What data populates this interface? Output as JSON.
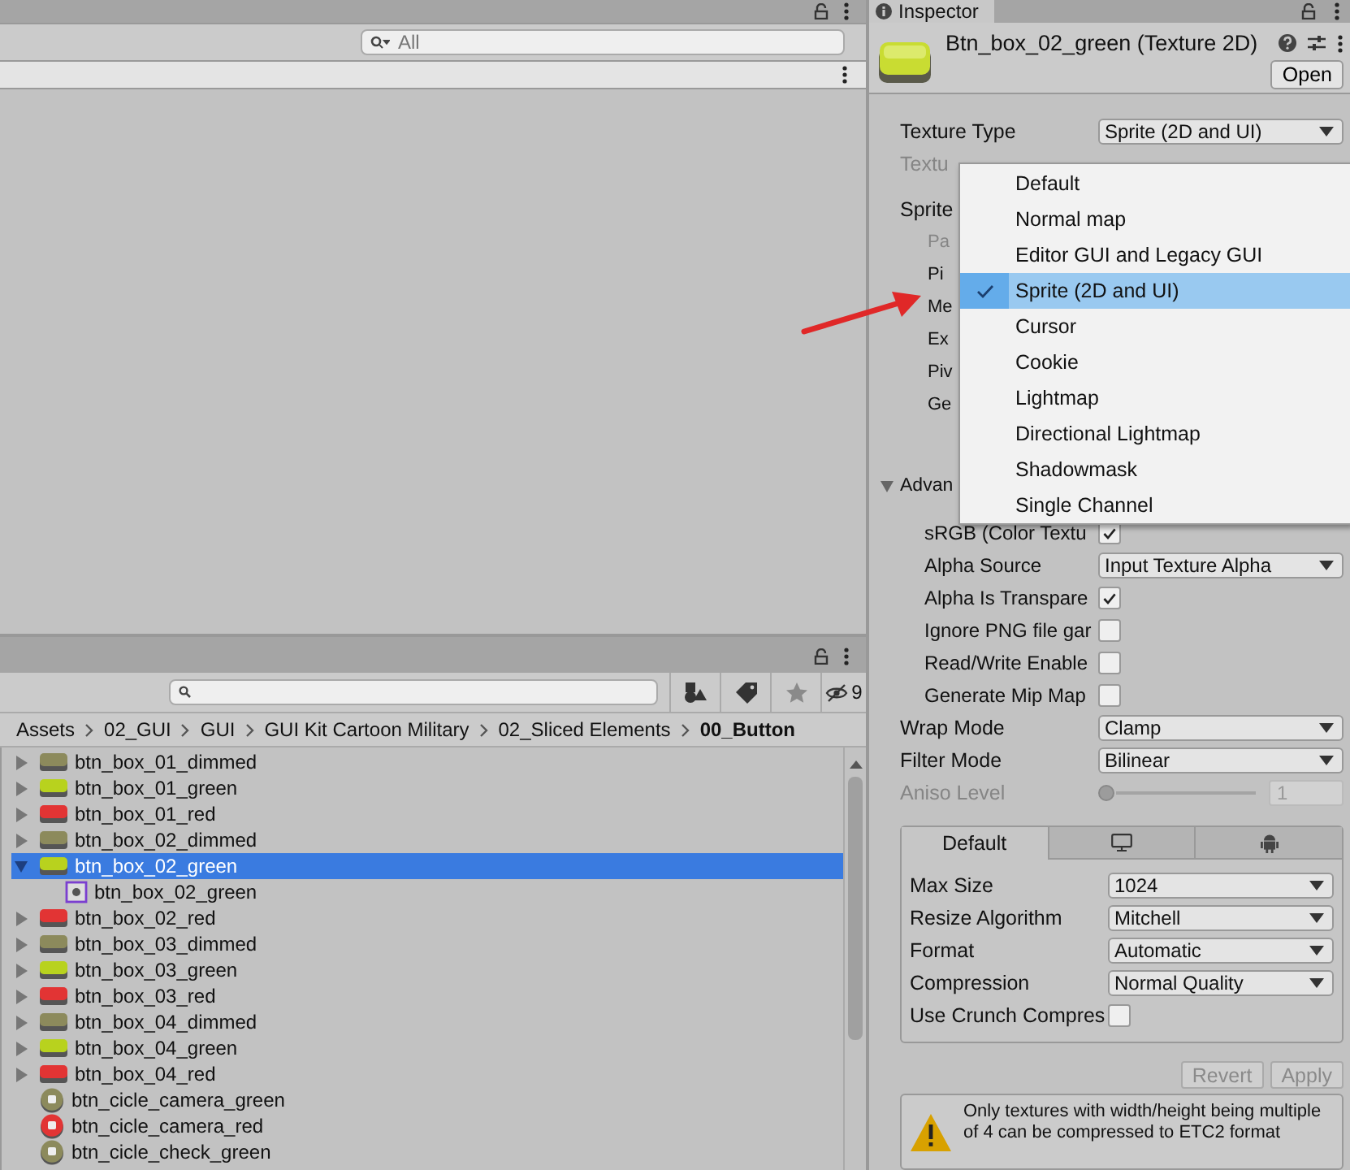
{
  "scene_panel": {
    "search": {
      "placeholder": "All"
    }
  },
  "project_panel": {
    "hidden_count": "9",
    "breadcrumb": [
      "Assets",
      "02_GUI",
      "GUI",
      "GUI Kit Cartoon Military",
      "02_Sliced Elements",
      "00_Button"
    ],
    "assets": [
      {
        "kind": "box",
        "name": "btn_box_01_dimmed",
        "color": "#8c8a5c",
        "expanded": false,
        "selected": false
      },
      {
        "kind": "box",
        "name": "btn_box_01_green",
        "color": "#b8d21e",
        "expanded": false,
        "selected": false
      },
      {
        "kind": "box",
        "name": "btn_box_01_red",
        "color": "#e23434",
        "expanded": false,
        "selected": false
      },
      {
        "kind": "box",
        "name": "btn_box_02_dimmed",
        "color": "#8c8a5c",
        "expanded": false,
        "selected": false
      },
      {
        "kind": "box",
        "name": "btn_box_02_green",
        "color": "#b8d21e",
        "expanded": true,
        "selected": true,
        "children": [
          {
            "kind": "sprite",
            "name": "btn_box_02_green",
            "selected": false
          }
        ]
      },
      {
        "kind": "box",
        "name": "btn_box_02_red",
        "color": "#e23434",
        "expanded": false,
        "selected": false
      },
      {
        "kind": "box",
        "name": "btn_box_03_dimmed",
        "color": "#8c8a5c",
        "expanded": false,
        "selected": false
      },
      {
        "kind": "box",
        "name": "btn_box_03_green",
        "color": "#b8d21e",
        "expanded": false,
        "selected": false
      },
      {
        "kind": "box",
        "name": "btn_box_03_red",
        "color": "#e23434",
        "expanded": false,
        "selected": false
      },
      {
        "kind": "box",
        "name": "btn_box_04_dimmed",
        "color": "#8c8a5c",
        "expanded": false,
        "selected": false
      },
      {
        "kind": "box",
        "name": "btn_box_04_green",
        "color": "#b8d21e",
        "expanded": false,
        "selected": false
      },
      {
        "kind": "box",
        "name": "btn_box_04_red",
        "color": "#e23434",
        "expanded": false,
        "selected": false
      },
      {
        "kind": "circle",
        "name": "btn_cicle_camera_green",
        "color": "#8c8a5c",
        "selected": false
      },
      {
        "kind": "circle",
        "name": "btn_cicle_camera_red",
        "color": "#e23434",
        "selected": false
      },
      {
        "kind": "circle",
        "name": "btn_cicle_check_green",
        "color": "#8c8a5c",
        "selected": false
      }
    ]
  },
  "inspector": {
    "tab": "Inspector",
    "asset_title": "Btn_box_02_green (Texture 2D)",
    "open_button": "Open",
    "properties": [
      {
        "kind": "dropdown",
        "label": "Texture Type",
        "value": "Sprite (2D and UI)"
      },
      {
        "kind": "text",
        "label": "Textu",
        "disabled": true
      },
      {
        "kind": "group",
        "label": "Sprite",
        "children": [
          {
            "kind": "text",
            "label": "Pa",
            "disabled": true
          },
          {
            "kind": "text",
            "label": "Pi",
            "disabled": false
          },
          {
            "kind": "text",
            "label": "Me",
            "disabled": false
          },
          {
            "kind": "text",
            "label": "Ex",
            "disabled": false
          },
          {
            "kind": "text",
            "label": "Piv",
            "disabled": false
          },
          {
            "kind": "text",
            "label": "Ge",
            "disabled": false
          }
        ]
      },
      {
        "kind": "foldout",
        "label": "Advan",
        "expanded": true,
        "children": [
          {
            "kind": "checkbox",
            "label": "sRGB (Color Textu",
            "checked": true
          },
          {
            "kind": "dropdown",
            "label": "Alpha Source",
            "value": "Input Texture Alpha"
          },
          {
            "kind": "checkbox",
            "label": "Alpha Is Transpare",
            "checked": true
          },
          {
            "kind": "checkbox",
            "label": "Ignore PNG file gar",
            "checked": false
          },
          {
            "kind": "checkbox",
            "label": "Read/Write Enable",
            "checked": false
          },
          {
            "kind": "checkbox",
            "label": "Generate Mip Map",
            "checked": false
          }
        ]
      }
    ],
    "properties_2": [
      {
        "kind": "dropdown",
        "label": "Wrap Mode",
        "value": "Clamp"
      },
      {
        "kind": "dropdown",
        "label": "Filter Mode",
        "value": "Bilinear"
      },
      {
        "kind": "slider",
        "label": "Aniso Level",
        "level": 0,
        "reading": "1",
        "disabled": true
      }
    ],
    "platform_tabs": [
      {
        "kind": "text",
        "label": "Default",
        "selected": true
      },
      {
        "kind": "monitor",
        "selected": false
      },
      {
        "kind": "android",
        "selected": false
      }
    ],
    "platform_settings": [
      {
        "kind": "dropdown",
        "label": "Max Size",
        "value": "1024"
      },
      {
        "kind": "dropdown",
        "label": "Resize Algorithm",
        "value": "Mitchell"
      },
      {
        "kind": "dropdown",
        "label": "Format",
        "value": "Automatic"
      },
      {
        "kind": "dropdown",
        "label": "Compression",
        "value": "Normal Quality"
      },
      {
        "kind": "checkbox",
        "label": "Use Crunch Compres",
        "checked": false
      }
    ],
    "buttons": [
      {
        "label": "Revert",
        "disabled": true
      },
      {
        "label": "Apply",
        "disabled": true
      }
    ],
    "warning": "Only textures with width/height being multiple of 4 can be compressed to ETC2 format"
  },
  "dropdown_menu": {
    "items": [
      {
        "label": "Default",
        "selected": false
      },
      {
        "label": "Normal map",
        "selected": false
      },
      {
        "label": "Editor GUI and Legacy GUI",
        "selected": false
      },
      {
        "label": "Sprite (2D and UI)",
        "selected": true
      },
      {
        "label": "Cursor",
        "selected": false
      },
      {
        "label": "Cookie",
        "selected": false
      },
      {
        "label": "Lightmap",
        "selected": false
      },
      {
        "label": "Directional Lightmap",
        "selected": false
      },
      {
        "label": "Shadowmask",
        "selected": false
      },
      {
        "label": "Single Channel",
        "selected": false
      }
    ]
  }
}
